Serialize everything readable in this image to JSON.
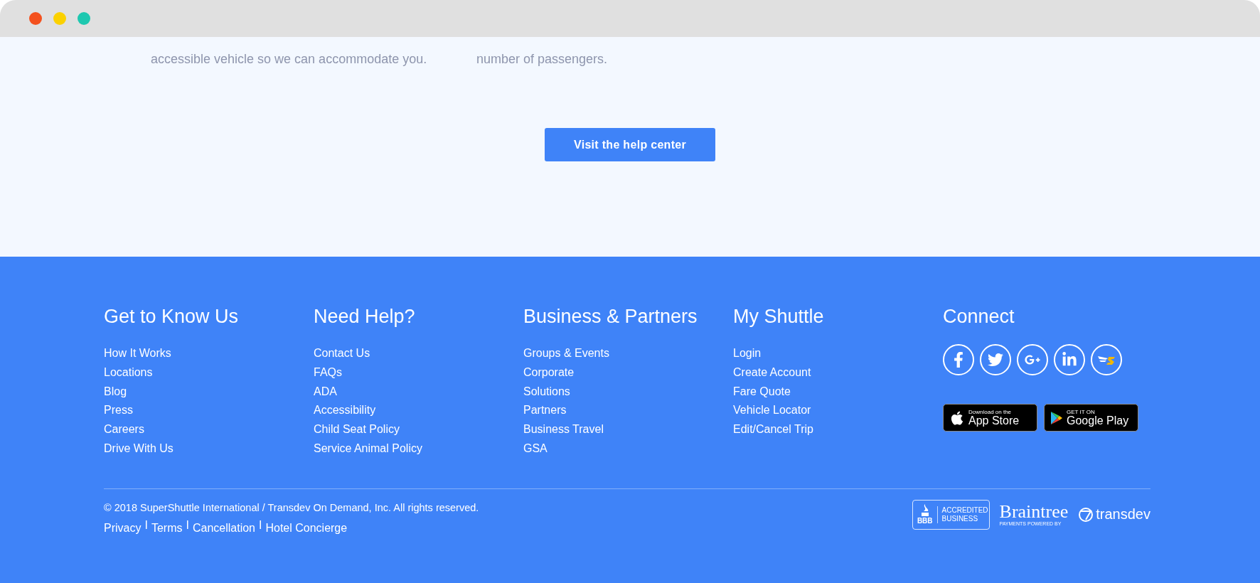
{
  "window": {
    "controls": [
      {
        "color": "#f4511e"
      },
      {
        "color": "#fbd100"
      },
      {
        "color": "#1ec8b0"
      }
    ]
  },
  "faq": {
    "columns": [
      "accessible vehicle so we can accommodate you.",
      "number of passengers."
    ],
    "button": "Visit the help center"
  },
  "footer": {
    "columns": [
      {
        "heading": "Get to Know Us",
        "links": [
          "How It Works",
          "Locations",
          "Blog",
          "Press",
          "Careers",
          "Drive With Us"
        ]
      },
      {
        "heading": "Need Help?",
        "links": [
          "Contact Us",
          "FAQs",
          "ADA",
          "Accessibility",
          "Child Seat Policy",
          "Service Animal Policy"
        ]
      },
      {
        "heading": "Business & Partners",
        "links": [
          "Groups & Events",
          "Corporate",
          "Solutions",
          "Partners",
          "Business Travel",
          "GSA"
        ]
      },
      {
        "heading": "My Shuttle",
        "links": [
          "Login",
          "Create Account",
          "Fare Quote",
          "Vehicle Locator",
          "Edit/Cancel Trip"
        ]
      }
    ],
    "connect": {
      "heading": "Connect",
      "social": [
        {
          "kind": "facebook"
        },
        {
          "kind": "twitter"
        },
        {
          "kind": "google-plus"
        },
        {
          "kind": "linkedin"
        },
        {
          "kind": "shuttle"
        }
      ],
      "stores": [
        {
          "kind": "apple",
          "small": "Download on the",
          "big": "App Store"
        },
        {
          "kind": "google",
          "small": "GET IT ON",
          "big": "Google Play"
        }
      ]
    },
    "copyright": "© 2018 SuperShuttle International / Transdev On Demand, Inc. All rights reserved.",
    "legal_links": [
      {
        "kind": "link",
        "text": "Privacy"
      },
      {
        "kind": "separator",
        "text": "I"
      },
      {
        "kind": "link",
        "text": "Terms"
      },
      {
        "kind": "separator",
        "text": "I"
      },
      {
        "kind": "link",
        "text": "Cancellation"
      },
      {
        "kind": "separator",
        "text": "I"
      },
      {
        "kind": "link",
        "text": "Hotel Concierge"
      }
    ],
    "badges": {
      "bbb": {
        "mark": "BBB",
        "text": "ACCREDITED BUSINESS"
      },
      "braintree": {
        "name": "Braintree",
        "sub": "PAYMENTS POWERED BY"
      },
      "transdev": {
        "name": "transdev"
      }
    }
  }
}
